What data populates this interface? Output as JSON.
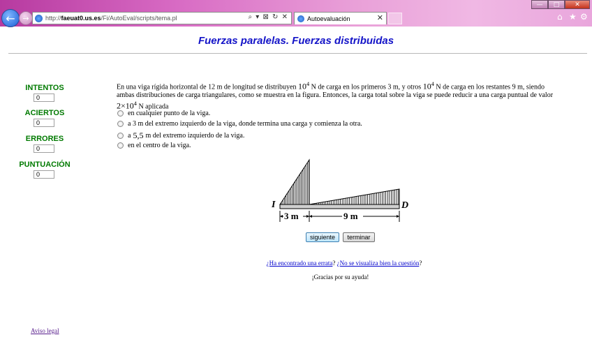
{
  "browser": {
    "url_prefix": "http://",
    "url_host": "faeuat0.us.es",
    "url_path": "/Fi/AutoEval/scripts/tema.pl",
    "address_tools": "⌕ ▾ ⊠ ↻ ✕",
    "tab_title": "Autoevaluación",
    "tab_close": "✕",
    "home_icon": "⌂",
    "favorites_icon": "★",
    "settings_icon": "⚙",
    "back_glyph": "←",
    "forward_glyph": "→",
    "min_glyph": "—",
    "max_glyph": "□",
    "close_glyph": "✕"
  },
  "page": {
    "title": "Fuerzas paralelas. Fuerzas distribuidas"
  },
  "sidebar": {
    "intentos_label": "INTENTOS",
    "intentos_value": "0",
    "aciertos_label": "ACIERTOS",
    "aciertos_value": "0",
    "errores_label": "ERRORES",
    "errores_value": "0",
    "puntuacion_label": "PUNTUACIÓN",
    "puntuacion_value": "0"
  },
  "question": {
    "part1": "En una viga rígida horizontal de 12 m de longitud se distribuyen ",
    "load1": "10",
    "load1_exp": "4",
    "part2": " N de carga en los primeros 3 m, y otros ",
    "load2": "10",
    "load2_exp": "4",
    "part3": " N de carga en los restantes 9 m, siendo ambas distribuciones de carga triangulares, como se muestra en la figura. Entonces, la carga total sobre la viga se puede reducir a una carga puntual de valor ",
    "total": "2×10",
    "total_exp": "4",
    "part4": " N aplicada"
  },
  "options": [
    {
      "label": "en cualquier punto de la viga."
    },
    {
      "label": "a 3 m del extremo izquierdo de la viga, donde termina una carga y comienza la otra."
    },
    {
      "label_pre": "a ",
      "value": "5,5",
      "label_post": " m del extremo izquierdo de la viga."
    },
    {
      "label": "en el centro de la viga."
    }
  ],
  "figure": {
    "left_label": "I",
    "right_label": "D",
    "dim1": "3 m",
    "dim2": "9 m"
  },
  "buttons": {
    "next": "siguiente",
    "finish": "terminar"
  },
  "footer": {
    "errata_link": "¿Ha encontrado una errata",
    "sep": "? ",
    "display_link": "¿No se visualiza bien la cuestión",
    "end": "?",
    "thanks": "¡Gracias por su ayuda!",
    "legal": "Aviso legal"
  }
}
